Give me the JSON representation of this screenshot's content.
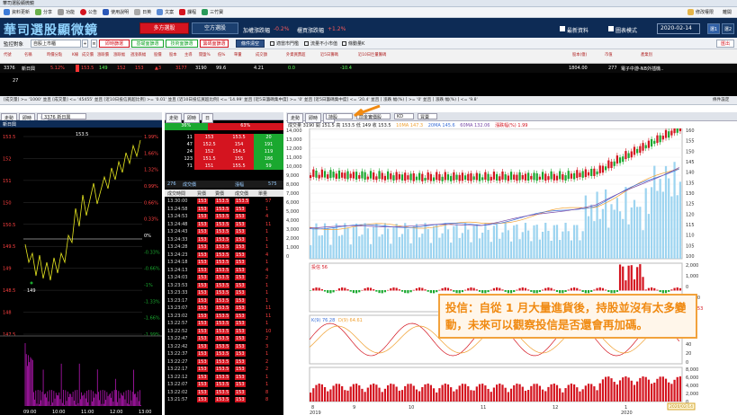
{
  "window_title": "華司選股顯微鏡",
  "menu": [
    "資料更新",
    "分享",
    "功能",
    "公告",
    "使用說明",
    "日英",
    "文案",
    "課程",
    "三竹寶"
  ],
  "menu_right": [
    "修改權限",
    "離開"
  ],
  "brand": {
    "logo": "華司選股顯微鏡",
    "tab_long": "多方選股",
    "tab_short": "空方選股",
    "up_label": "加權漲跌幅",
    "up_value": "-0.2%",
    "otc_label": "櫃買漲跌幅",
    "otc_value": "+1.2%",
    "latest_label": "最新資料",
    "chart_mode": "圖表模式",
    "date": "2020-02-14",
    "btn1": "選1",
    "btn2": "選2"
  },
  "filter": {
    "label": "監控對象",
    "select": "自股上市櫃",
    "b1": "即時篩選",
    "b2": "基礎面篩選",
    "b3": "技術面篩選",
    "b4": "籌碼面篩選",
    "b5": "條件清空",
    "c1": "適當市門檻",
    "c2": "流量不小市值",
    "c3": "條動量K",
    "export": "匯出"
  },
  "headers": [
    "代號",
    "名稱",
    "時價分點",
    "K線",
    "成交價",
    "漲跌價",
    "漲跌幅",
    "週漲跌幅",
    "股價",
    "股本",
    "主導",
    "開盤%",
    "低%",
    "單量",
    "成交額",
    "外資買賣超",
    "近5日籌碼",
    "近10日巨量籌碼",
    "股本(億)",
    "市值",
    "產業別"
  ],
  "row": {
    "code": "3376",
    "name": "新日興",
    "c3": "5.12%",
    "c4": "153.5",
    "c5": "149",
    "c6": "152",
    "c7": "153",
    "c8": "▲3",
    "c9": "3177",
    "c10": "3190",
    "c11": "99.6",
    "c12": "4.21",
    "c13": "0.0",
    "c14": "-10.4",
    "c15": "1804.00",
    "c16": "277",
    "c17": "電子中游-NB外插機.."
  },
  "row2_val": "27",
  "cond_text": "[成交量] >= '1000' 並且 [成交量] <= '45455' 並且 [近10日投信買超比例] >= '0.01' 並且 [近10日投信買超比例] <= '14.99' 並且 [近5日籌碼集中度] >= '0' 並且 [近5日籌碼集中度] <= '20.4' 並且 [ 漲跌 幅(%) ] >= '0' 並且 [ 漲跌 幅(%) ] <= '9.8'",
  "cond_right": "條件設定",
  "left": {
    "tabs": [
      "走勢",
      "即時",
      "日"
    ],
    "stock": "3376 新日興",
    "sub": "新日興",
    "prices": [
      "153.5",
      "152",
      "151",
      "150",
      "150.5",
      "149.5",
      "149",
      "148.5",
      "148",
      "147.5"
    ],
    "pcts": [
      "1.99%",
      "1.66%",
      "1.32%",
      "0.99%",
      "0.66%",
      "0.33%",
      "0%",
      "-0.33%",
      "-0.66%",
      "-1%",
      "-1.33%",
      "-1.66%",
      "-1.99%"
    ],
    "hi": "153.5",
    "lo": "149",
    "times": [
      "09:00",
      "10:00",
      "11:00",
      "12:00",
      "13:00"
    ]
  },
  "mid": {
    "buy_pct": "36%",
    "sell_pct": "63%",
    "order_rows": [
      [
        "11",
        "153",
        "153.5",
        "20"
      ],
      [
        "47",
        "152.5",
        "154",
        "191"
      ],
      [
        "24",
        "152",
        "154.5",
        "119"
      ],
      [
        "123",
        "151.5",
        "155",
        "186"
      ],
      [
        "71",
        "151",
        "155.5",
        "59"
      ]
    ],
    "tabs": [
      "276",
      "成交價",
      "漲幅",
      "漲跌幅",
      "575"
    ],
    "ticks_header": [
      "成交時間",
      "買價",
      "賣價",
      "成交價",
      "單量"
    ],
    "ticks": [
      [
        "13:30:00",
        "153",
        "153.5",
        "153.5",
        "57"
      ],
      [
        "13:24:58",
        "153",
        "153.5",
        "153",
        "1"
      ],
      [
        "13:24:53",
        "153",
        "153.5",
        "153",
        "4"
      ],
      [
        "13:24:48",
        "153",
        "153.5",
        "153",
        "11"
      ],
      [
        "13:24:43",
        "153",
        "153.5",
        "153",
        "1"
      ],
      [
        "13:24:33",
        "153",
        "153.5",
        "153",
        "1"
      ],
      [
        "13:24:28",
        "153",
        "153.5",
        "153",
        "1"
      ],
      [
        "13:24:23",
        "153",
        "153.5",
        "153",
        "4"
      ],
      [
        "13:24:18",
        "153",
        "153.5",
        "153",
        "1"
      ],
      [
        "13:24:13",
        "153",
        "153.5",
        "153",
        "4"
      ],
      [
        "13:24:03",
        "153",
        "153.5",
        "153",
        "2"
      ],
      [
        "13:23:53",
        "153",
        "153.5",
        "153",
        "1"
      ],
      [
        "13:23:33",
        "153",
        "153.5",
        "153",
        "1"
      ],
      [
        "13:23:17",
        "153",
        "153.5",
        "153",
        "1"
      ],
      [
        "13:23:07",
        "153",
        "153.5",
        "153",
        "11"
      ],
      [
        "13:23:02",
        "153",
        "153.5",
        "153",
        "11"
      ],
      [
        "13:22:57",
        "153",
        "153.5",
        "153",
        "1"
      ],
      [
        "13:22:52",
        "153",
        "153.5",
        "153",
        "10"
      ],
      [
        "13:22:47",
        "153",
        "153.5",
        "153",
        "2"
      ],
      [
        "13:22:42",
        "153",
        "153.5",
        "153",
        "3"
      ],
      [
        "13:22:37",
        "153",
        "153.5",
        "153",
        "1"
      ],
      [
        "13:22:27",
        "153",
        "153.5",
        "153",
        "2"
      ],
      [
        "13:22:17",
        "153",
        "153.5",
        "153",
        "2"
      ],
      [
        "13:22:12",
        "153",
        "153.5",
        "153",
        "1"
      ],
      [
        "13:22:07",
        "153",
        "153.5",
        "153",
        "1"
      ],
      [
        "13:22:02",
        "153",
        "153.5",
        "153",
        "8"
      ],
      [
        "13:21:57",
        "153",
        "153.5",
        "153",
        "8"
      ]
    ]
  },
  "right": {
    "tabs": [
      "走勢",
      "即時",
      "日"
    ],
    "sel1": "持股",
    "sel2": "前金實價股",
    "sel3": "KD",
    "sel4": "買賣",
    "ohlc": "成交量 3190  開 151.5  高 153.5  低 149  收 153.5",
    "ma10": "10MA 147.3",
    "ma20": "20MA 145.6",
    "ma60": "60MA 132.06",
    "ma_last": "漲跌幅(%) 1.99",
    "vol_ticks": [
      "14,000",
      "13,000",
      "12,000",
      "11,000",
      "10,000",
      "9,000",
      "8,000",
      "7,000",
      "6,000",
      "5,000",
      "4,000",
      "3,000",
      "2,000",
      "1,000",
      "0"
    ],
    "price_ticks": [
      "160",
      "155",
      "150",
      "145",
      "140",
      "135",
      "130",
      "125",
      "120",
      "115",
      "110",
      "105",
      "100"
    ],
    "inst_label": "投信 56",
    "inst_ticks": [
      "2,000",
      "1,000",
      "0",
      "-1,000",
      "-789.53"
    ],
    "kd_label": "K(9) 76.28",
    "kd_label2": "D(9) 64.61",
    "kd_ticks": [
      "100",
      "80",
      "60",
      "40",
      "20",
      "0"
    ],
    "bvol_ticks": [
      "8,000",
      "6,000",
      "4,000",
      "2,000",
      "0"
    ],
    "months": [
      "8",
      "9",
      "10",
      "11",
      "12",
      "1",
      "2"
    ],
    "years": [
      "2019",
      "2020"
    ],
    "date_box": "2020/02/14"
  },
  "annotation": "投信：自從 1 月大量進貨後，持股並沒有太多變動，未來可以觀察投信是否還會再加碼。",
  "colors": {
    "red": "#d4141f",
    "green": "#1aa82f",
    "navy": "#0d2b55",
    "annot": "#f08a12"
  }
}
